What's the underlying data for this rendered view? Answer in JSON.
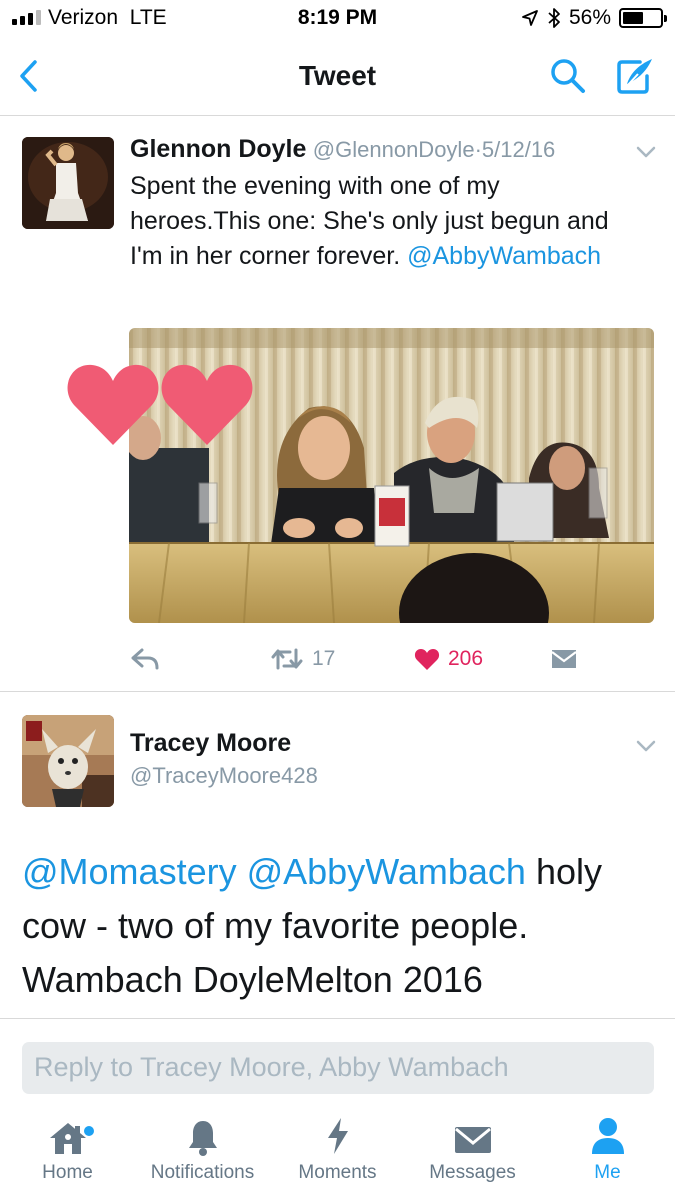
{
  "status_bar": {
    "carrier": "Verizon",
    "network": "LTE",
    "time": "8:19 PM",
    "battery": "56%",
    "battery_level": 0.56,
    "signal_bars": 3,
    "icons": [
      "location-arrow-icon",
      "bluetooth-icon",
      "battery-icon"
    ]
  },
  "nav": {
    "title": "Tweet",
    "icons": [
      "back-chevron-icon",
      "search-icon",
      "compose-icon"
    ],
    "accent": "#1da1f2"
  },
  "tweet": {
    "author_name": "Glennon Doyle",
    "author_handle": "@GlennonDoyle",
    "separator": "·",
    "date": "5/12/16",
    "text": "Spent the evening with one of my heroes.This one: She's only just begun and I'm in her corner forever.",
    "mention": "@AbbyWambach",
    "media_description_icons": [
      "heart-sticker-icon"
    ],
    "actions": {
      "retweet_count": "17",
      "like_count": "206",
      "liked": true,
      "like_color": "#e0245e"
    }
  },
  "reply_tweet": {
    "author_name": "Tracey Moore",
    "author_handle": "@TraceyMoore428",
    "mention1": "@Momastery",
    "mention2": "@AbbyWambach",
    "text": "holy cow - two of my favorite people. Wambach DoyleMelton 2016"
  },
  "reply_field": {
    "placeholder": "Reply to Tracey Moore, Abby Wambach"
  },
  "tab_bar": {
    "tabs": [
      {
        "label": "Home",
        "icon": "home-icon",
        "badge": true
      },
      {
        "label": "Notifications",
        "icon": "bell-icon"
      },
      {
        "label": "Moments",
        "icon": "lightning-icon"
      },
      {
        "label": "Messages",
        "icon": "envelope-icon"
      },
      {
        "label": "Me",
        "icon": "person-icon",
        "active": true
      }
    ],
    "active_color": "#1da1f2",
    "inactive_color": "#657786"
  }
}
